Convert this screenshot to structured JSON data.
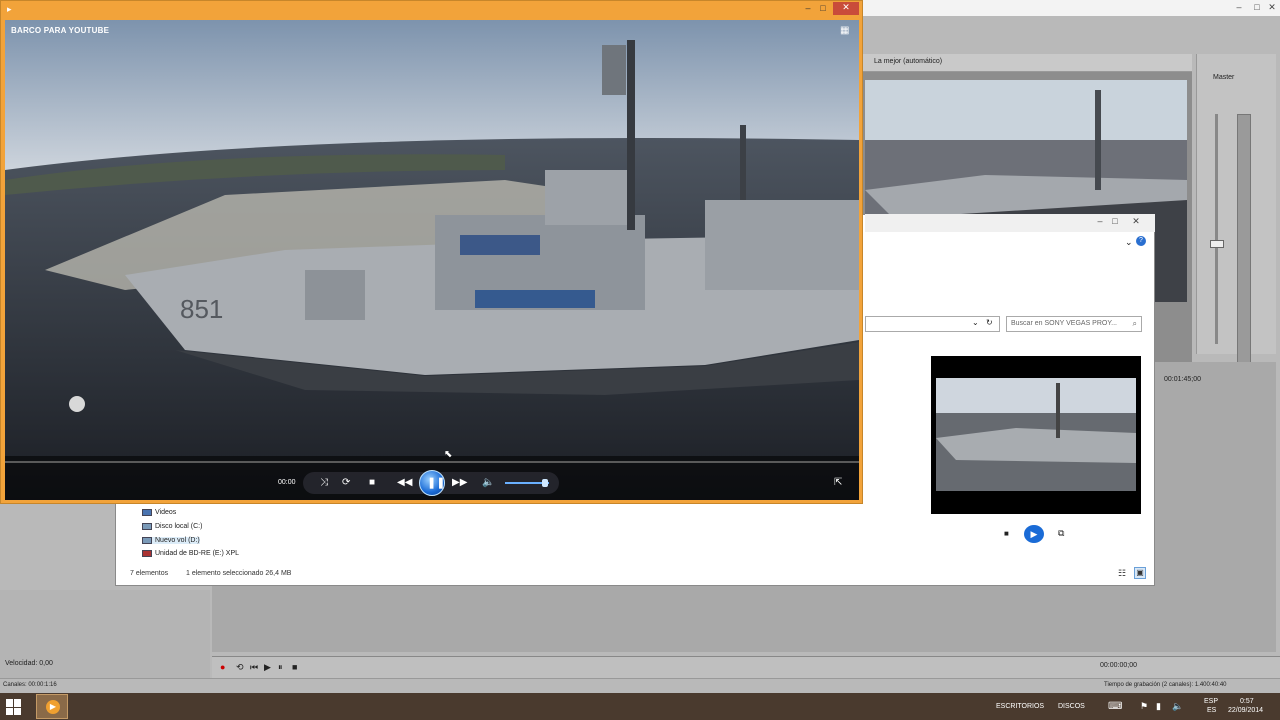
{
  "player": {
    "title": "BARCO PARA YOUTUBE",
    "timecode": "00:00",
    "controls": {
      "shuffle": "shuffle",
      "repeat": "repeat",
      "stop": "stop",
      "prev": "previous",
      "pause": "pause",
      "next": "next",
      "mute": "volume"
    }
  },
  "explorer": {
    "search_placeholder": "Buscar en SONY VEGAS PROY...",
    "tree": [
      {
        "label": "Videos"
      },
      {
        "label": "Disco local (C:)"
      },
      {
        "label": "Nuevo vol (D:)"
      },
      {
        "label": "Unidad de BD-RE (E:) XPL"
      }
    ],
    "status_items": "7 elementos",
    "status_selected": "1 elemento seleccionado  26,4 MB"
  },
  "vegas": {
    "preview_quality": "La mejor (automático)",
    "mixer_label": "Master",
    "velocidad": "Velocidad: 0,00",
    "canales": "Canales: 00:00:1:16",
    "record_time": "Tiempo de grabación (2 canales): 1.400:40:40",
    "time_readout": "00:00:00;00",
    "timeline_marker": "00:01:45;00"
  },
  "taskbar": {
    "toolbar_label": "ESCRITORIOS",
    "discs_label": "DISCOS",
    "lang": "ESP",
    "lang_sub": "ES",
    "clock_time": "0:57",
    "clock_date": "22/09/2014"
  },
  "colors": {
    "player_frame": "#f2a33a",
    "accent": "#1a6bd6",
    "taskbar": "#4a3a2e"
  }
}
